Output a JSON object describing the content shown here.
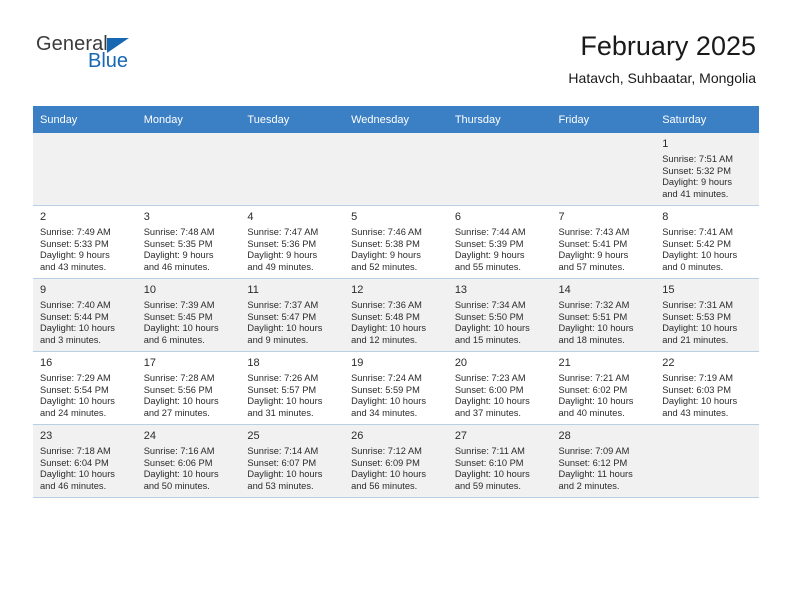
{
  "brand": {
    "name_part1": "General",
    "name_part2": "Blue",
    "accent_color": "#1668b3"
  },
  "header": {
    "title": "February 2025",
    "subtitle": "Hatavch, Suhbaatar, Mongolia",
    "header_bg_color": "#3b7fc4"
  },
  "weekdays": [
    "Sunday",
    "Monday",
    "Tuesday",
    "Wednesday",
    "Thursday",
    "Friday",
    "Saturday"
  ],
  "labels": {
    "sunrise": "Sunrise:",
    "sunset": "Sunset:",
    "daylight": "Daylight:"
  },
  "weeks": [
    [
      {
        "day": "",
        "empty": true
      },
      {
        "day": "",
        "empty": true
      },
      {
        "day": "",
        "empty": true
      },
      {
        "day": "",
        "empty": true
      },
      {
        "day": "",
        "empty": true
      },
      {
        "day": "",
        "empty": true
      },
      {
        "day": "1",
        "sunrise": "Sunrise: 7:51 AM",
        "sunset": "Sunset: 5:32 PM",
        "daylight_line1": "Daylight: 9 hours",
        "daylight_line2": "and 41 minutes."
      }
    ],
    [
      {
        "day": "2",
        "sunrise": "Sunrise: 7:49 AM",
        "sunset": "Sunset: 5:33 PM",
        "daylight_line1": "Daylight: 9 hours",
        "daylight_line2": "and 43 minutes."
      },
      {
        "day": "3",
        "sunrise": "Sunrise: 7:48 AM",
        "sunset": "Sunset: 5:35 PM",
        "daylight_line1": "Daylight: 9 hours",
        "daylight_line2": "and 46 minutes."
      },
      {
        "day": "4",
        "sunrise": "Sunrise: 7:47 AM",
        "sunset": "Sunset: 5:36 PM",
        "daylight_line1": "Daylight: 9 hours",
        "daylight_line2": "and 49 minutes."
      },
      {
        "day": "5",
        "sunrise": "Sunrise: 7:46 AM",
        "sunset": "Sunset: 5:38 PM",
        "daylight_line1": "Daylight: 9 hours",
        "daylight_line2": "and 52 minutes."
      },
      {
        "day": "6",
        "sunrise": "Sunrise: 7:44 AM",
        "sunset": "Sunset: 5:39 PM",
        "daylight_line1": "Daylight: 9 hours",
        "daylight_line2": "and 55 minutes."
      },
      {
        "day": "7",
        "sunrise": "Sunrise: 7:43 AM",
        "sunset": "Sunset: 5:41 PM",
        "daylight_line1": "Daylight: 9 hours",
        "daylight_line2": "and 57 minutes."
      },
      {
        "day": "8",
        "sunrise": "Sunrise: 7:41 AM",
        "sunset": "Sunset: 5:42 PM",
        "daylight_line1": "Daylight: 10 hours",
        "daylight_line2": "and 0 minutes."
      }
    ],
    [
      {
        "day": "9",
        "sunrise": "Sunrise: 7:40 AM",
        "sunset": "Sunset: 5:44 PM",
        "daylight_line1": "Daylight: 10 hours",
        "daylight_line2": "and 3 minutes."
      },
      {
        "day": "10",
        "sunrise": "Sunrise: 7:39 AM",
        "sunset": "Sunset: 5:45 PM",
        "daylight_line1": "Daylight: 10 hours",
        "daylight_line2": "and 6 minutes."
      },
      {
        "day": "11",
        "sunrise": "Sunrise: 7:37 AM",
        "sunset": "Sunset: 5:47 PM",
        "daylight_line1": "Daylight: 10 hours",
        "daylight_line2": "and 9 minutes."
      },
      {
        "day": "12",
        "sunrise": "Sunrise: 7:36 AM",
        "sunset": "Sunset: 5:48 PM",
        "daylight_line1": "Daylight: 10 hours",
        "daylight_line2": "and 12 minutes."
      },
      {
        "day": "13",
        "sunrise": "Sunrise: 7:34 AM",
        "sunset": "Sunset: 5:50 PM",
        "daylight_line1": "Daylight: 10 hours",
        "daylight_line2": "and 15 minutes."
      },
      {
        "day": "14",
        "sunrise": "Sunrise: 7:32 AM",
        "sunset": "Sunset: 5:51 PM",
        "daylight_line1": "Daylight: 10 hours",
        "daylight_line2": "and 18 minutes."
      },
      {
        "day": "15",
        "sunrise": "Sunrise: 7:31 AM",
        "sunset": "Sunset: 5:53 PM",
        "daylight_line1": "Daylight: 10 hours",
        "daylight_line2": "and 21 minutes."
      }
    ],
    [
      {
        "day": "16",
        "sunrise": "Sunrise: 7:29 AM",
        "sunset": "Sunset: 5:54 PM",
        "daylight_line1": "Daylight: 10 hours",
        "daylight_line2": "and 24 minutes."
      },
      {
        "day": "17",
        "sunrise": "Sunrise: 7:28 AM",
        "sunset": "Sunset: 5:56 PM",
        "daylight_line1": "Daylight: 10 hours",
        "daylight_line2": "and 27 minutes."
      },
      {
        "day": "18",
        "sunrise": "Sunrise: 7:26 AM",
        "sunset": "Sunset: 5:57 PM",
        "daylight_line1": "Daylight: 10 hours",
        "daylight_line2": "and 31 minutes."
      },
      {
        "day": "19",
        "sunrise": "Sunrise: 7:24 AM",
        "sunset": "Sunset: 5:59 PM",
        "daylight_line1": "Daylight: 10 hours",
        "daylight_line2": "and 34 minutes."
      },
      {
        "day": "20",
        "sunrise": "Sunrise: 7:23 AM",
        "sunset": "Sunset: 6:00 PM",
        "daylight_line1": "Daylight: 10 hours",
        "daylight_line2": "and 37 minutes."
      },
      {
        "day": "21",
        "sunrise": "Sunrise: 7:21 AM",
        "sunset": "Sunset: 6:02 PM",
        "daylight_line1": "Daylight: 10 hours",
        "daylight_line2": "and 40 minutes."
      },
      {
        "day": "22",
        "sunrise": "Sunrise: 7:19 AM",
        "sunset": "Sunset: 6:03 PM",
        "daylight_line1": "Daylight: 10 hours",
        "daylight_line2": "and 43 minutes."
      }
    ],
    [
      {
        "day": "23",
        "sunrise": "Sunrise: 7:18 AM",
        "sunset": "Sunset: 6:04 PM",
        "daylight_line1": "Daylight: 10 hours",
        "daylight_line2": "and 46 minutes."
      },
      {
        "day": "24",
        "sunrise": "Sunrise: 7:16 AM",
        "sunset": "Sunset: 6:06 PM",
        "daylight_line1": "Daylight: 10 hours",
        "daylight_line2": "and 50 minutes."
      },
      {
        "day": "25",
        "sunrise": "Sunrise: 7:14 AM",
        "sunset": "Sunset: 6:07 PM",
        "daylight_line1": "Daylight: 10 hours",
        "daylight_line2": "and 53 minutes."
      },
      {
        "day": "26",
        "sunrise": "Sunrise: 7:12 AM",
        "sunset": "Sunset: 6:09 PM",
        "daylight_line1": "Daylight: 10 hours",
        "daylight_line2": "and 56 minutes."
      },
      {
        "day": "27",
        "sunrise": "Sunrise: 7:11 AM",
        "sunset": "Sunset: 6:10 PM",
        "daylight_line1": "Daylight: 10 hours",
        "daylight_line2": "and 59 minutes."
      },
      {
        "day": "28",
        "sunrise": "Sunrise: 7:09 AM",
        "sunset": "Sunset: 6:12 PM",
        "daylight_line1": "Daylight: 11 hours",
        "daylight_line2": "and 2 minutes."
      },
      {
        "day": "",
        "empty": true
      }
    ]
  ]
}
